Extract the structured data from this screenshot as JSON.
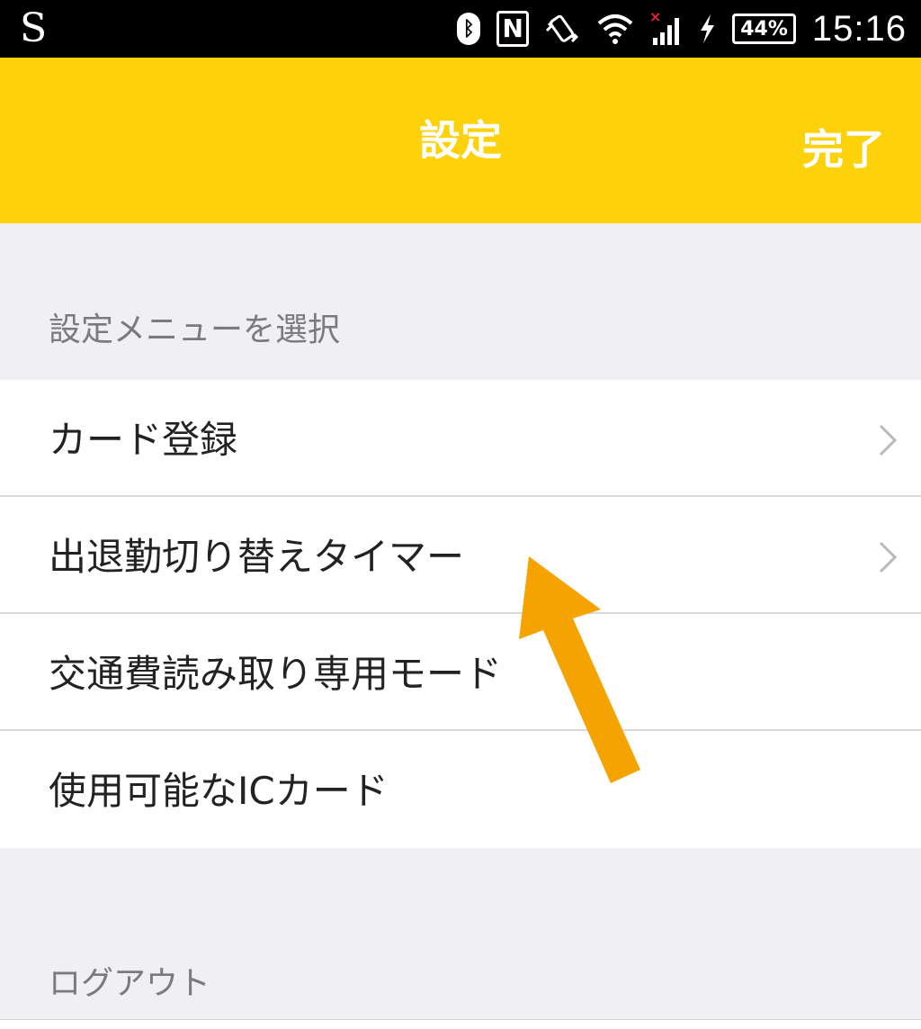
{
  "status_bar": {
    "logo": "S",
    "bluetooth": "bluetooth-icon",
    "nfc_label": "N",
    "battery": "44%",
    "time": "15:16"
  },
  "header": {
    "title": "設定",
    "done_label": "完了",
    "background_color": "#fdd20b"
  },
  "sections": {
    "menu_label": "設定メニューを選択",
    "logout_label": "ログアウト"
  },
  "menu_items": [
    {
      "label": "カード登録",
      "has_chevron": true
    },
    {
      "label": "出退勤切り替えタイマー",
      "has_chevron": true
    },
    {
      "label": "交通費読み取り専用モード",
      "has_chevron": false
    },
    {
      "label": "使用可能なICカード",
      "has_chevron": false
    }
  ],
  "annotation": {
    "arrow_color": "#f5a300"
  }
}
